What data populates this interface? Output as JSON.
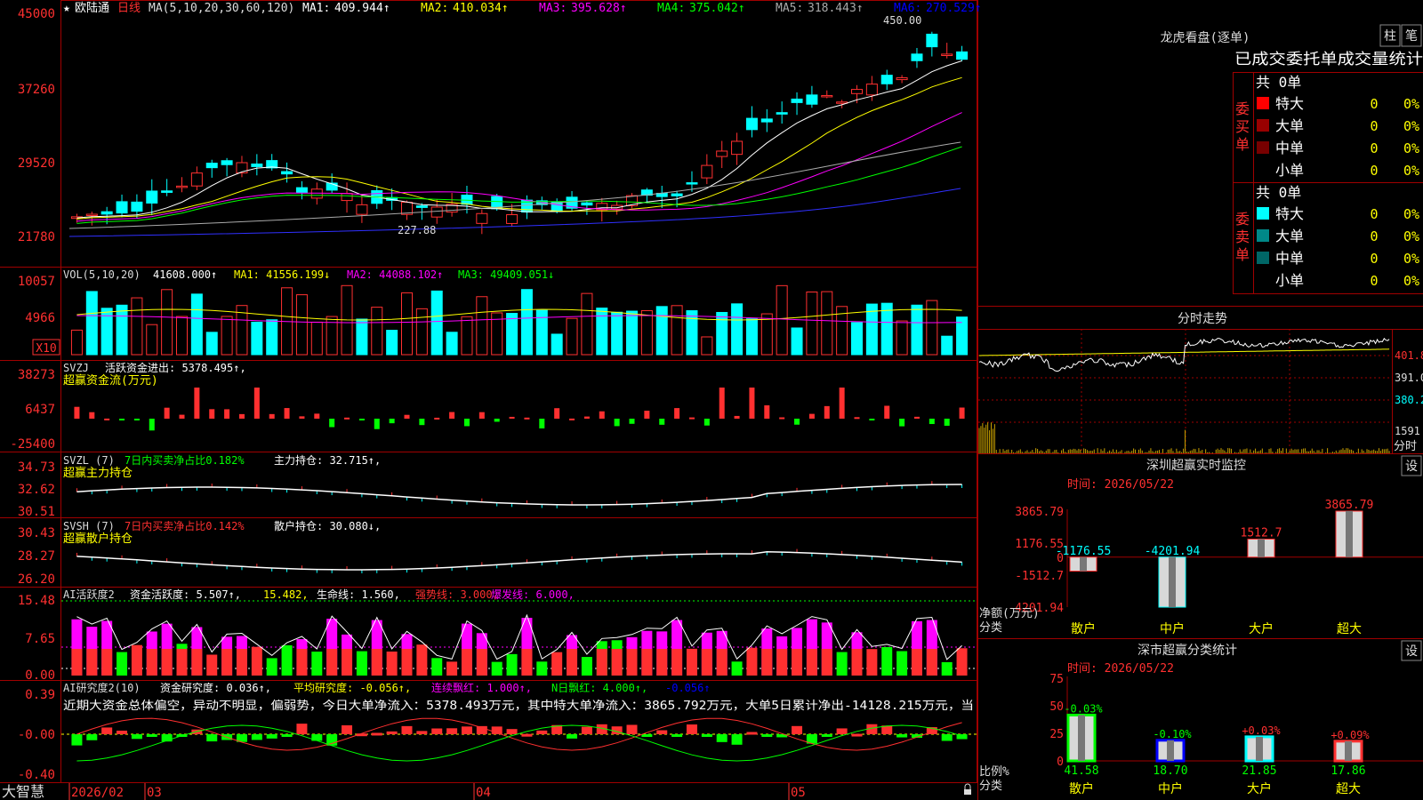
{
  "app": {
    "brand": "大智慧"
  },
  "stock": {
    "name": "欧陆通",
    "period": "日线"
  },
  "main_panel": {
    "ma_title": "MA(5,10,20,30,60,120)",
    "ma_values": [
      {
        "label": "MA1:",
        "value": "409.944↑",
        "color": "#ffffff"
      },
      {
        "label": "MA2:",
        "value": "410.034↑",
        "color": "#ffff00"
      },
      {
        "label": "MA3:",
        "value": "395.628↑",
        "color": "#ff00ff"
      },
      {
        "label": "MA4:",
        "value": "375.042↑",
        "color": "#00ff00"
      },
      {
        "label": "MA5:",
        "value": "318.443↑",
        "color": "#aaaaaa"
      },
      {
        "label": "MA6:",
        "value": "270.529↑",
        "color": "#0000ff"
      }
    ],
    "axis_labels": [
      "45000",
      "37260",
      "29520",
      "21780"
    ],
    "high_marker": "450.00",
    "low_marker": "227.88"
  },
  "vol_panel": {
    "title": "VOL(5,10,20)",
    "value": "41608.000↑",
    "ma1": "MA1: 41556.199↓",
    "ma2": "MA2: 44088.102↑",
    "ma3": "MA3: 49409.051↓",
    "axis_labels": [
      "10057",
      "4966"
    ],
    "unit": "X10"
  },
  "svzj_panel": {
    "title": "SVZJ",
    "label": "活跃资金进出: 5378.495↑,",
    "sub": "超赢资金流(万元)",
    "axis_labels": [
      "38273",
      "6437",
      "-25400"
    ]
  },
  "svzl_panel": {
    "title": "SVZL (7)",
    "ratio": "7日内买卖净占比0.182%",
    "hold": "主力持仓: 32.715↑,",
    "sub": "超赢主力持仓",
    "axis_labels": [
      "34.73",
      "32.62",
      "30.51"
    ]
  },
  "svsh_panel": {
    "title": "SVSH (7)",
    "ratio": "7日内买卖净占比0.142%",
    "hold": "散户持仓: 30.080↓,",
    "sub": "超赢散户持仓",
    "axis_labels": [
      "30.43",
      "28.27",
      "26.20"
    ]
  },
  "ai1_panel": {
    "title": "AI活跃度2",
    "activity": "资金活跃度: 5.507↑,",
    "v2": "15.482,",
    "life": "生命线: 1.560,",
    "strong": "强势线: 3.000,",
    "burst": "爆发线: 6.000,",
    "axis_labels": [
      "15.48",
      "7.65",
      "0.00"
    ]
  },
  "ai2_panel": {
    "title": "AI研究度2(10)",
    "research": "资金研究度: 0.036↑,",
    "avg": "平均研究度: -0.056↑,",
    "red": "连续飘红: 1.000↑,",
    "nred": "N日飘红: 4.000↑,",
    "tail": "-0.056↑",
    "comment": "近期大资金总体偏空，异动不明显，偏弱势，今日大单净流入：5378.493万元，其中特大单净流入：3865.792万元，大单5日累计净出-14128.215万元，当",
    "axis_labels": [
      "0.39",
      "-0.00",
      "-0.40"
    ]
  },
  "x_axis": {
    "labels": [
      "2026/02",
      "03",
      "04",
      "05"
    ]
  },
  "dragon": {
    "title": "龙虎看盘(逐单)",
    "btn1": "柱",
    "btn2": "笔",
    "header": "已成交委托单成交量统计",
    "buy_group": "委买单",
    "sell_group": "委卖单",
    "buy_total": "共 0单",
    "sell_total": "共 0单",
    "buy_rows": [
      {
        "label": "特大",
        "count": "0",
        "pct": "0%",
        "color": "#ff0000"
      },
      {
        "label": "大单",
        "count": "0",
        "pct": "0%",
        "color": "#990000"
      },
      {
        "label": "中单",
        "count": "0",
        "pct": "0%",
        "color": "#770000"
      },
      {
        "label": "小单",
        "count": "0",
        "pct": "0%",
        "color": ""
      }
    ],
    "sell_rows": [
      {
        "label": "特大",
        "count": "0",
        "pct": "0%",
        "color": "#00ffff"
      },
      {
        "label": "大单",
        "count": "0",
        "pct": "0%",
        "color": "#008888"
      },
      {
        "label": "中单",
        "count": "0",
        "pct": "0%",
        "color": "#006666"
      },
      {
        "label": "小单",
        "count": "0",
        "pct": "0%",
        "color": ""
      }
    ]
  },
  "intraday": {
    "title": "分时走势",
    "axis_labels": [
      "401.8",
      "391.0",
      "380.2",
      "1591",
      "分时"
    ]
  },
  "monitor": {
    "title": "深圳超赢实时监控",
    "set_btn": "设",
    "time": "时间: 2026/05/22",
    "axis_labels": [
      "3865.79",
      "1176.55",
      "0",
      "-1512.7",
      "-4201.94"
    ],
    "y_title": "净额(万元)",
    "x_title": "分类",
    "bars": [
      {
        "name": "散户",
        "value": -1176.55,
        "label": "-1176.55"
      },
      {
        "name": "中户",
        "value": -4201.94,
        "label": "-4201.94"
      },
      {
        "name": "大户",
        "value": 1512.7,
        "label": "1512.7"
      },
      {
        "name": "超大",
        "value": 3865.79,
        "label": "3865.79"
      }
    ]
  },
  "classify": {
    "title": "深市超赢分类统计",
    "set_btn": "设",
    "time": "时间: 2026/05/22",
    "axis_labels": [
      "75",
      "50",
      "25",
      "0"
    ],
    "y_title": "比例%",
    "x_title": "分类",
    "bars": [
      {
        "name": "散户",
        "value": 41.58,
        "label": "41.58",
        "change": "-0.03%"
      },
      {
        "name": "中户",
        "value": 18.7,
        "label": "18.70",
        "change": "-0.10%"
      },
      {
        "name": "大户",
        "value": 21.85,
        "label": "21.85",
        "change": "+0.03%"
      },
      {
        "name": "超大",
        "value": 17.86,
        "label": "17.86",
        "change": "+0.09%"
      }
    ]
  },
  "chart_data": [
    {
      "type": "bar",
      "title": "深圳超赢实时监控",
      "categories": [
        "散户",
        "中户",
        "大户",
        "超大"
      ],
      "values": [
        -1176.55,
        -4201.94,
        1512.7,
        3865.79
      ],
      "xlabel": "分类",
      "ylabel": "净额(万元)",
      "ylim": [
        -4201.94,
        3865.79
      ]
    },
    {
      "type": "bar",
      "title": "深市超赢分类统计",
      "categories": [
        "散户",
        "中户",
        "大户",
        "超大"
      ],
      "values": [
        41.58,
        18.7,
        21.85,
        17.86
      ],
      "xlabel": "分类",
      "ylabel": "比例%",
      "ylim": [
        0,
        75
      ]
    },
    {
      "type": "line",
      "title": "",
      "ylim": [
        21780,
        45000
      ],
      "series": [
        {
          "name": "MA1",
          "last": 409.944
        },
        {
          "name": "MA2",
          "last": 410.034
        },
        {
          "name": "MA3",
          "last": 395.628
        },
        {
          "name": "MA4",
          "last": 375.042
        },
        {
          "name": "MA5",
          "last": 318.443
        },
        {
          "name": "MA6",
          "last": 270.529
        }
      ]
    }
  ]
}
